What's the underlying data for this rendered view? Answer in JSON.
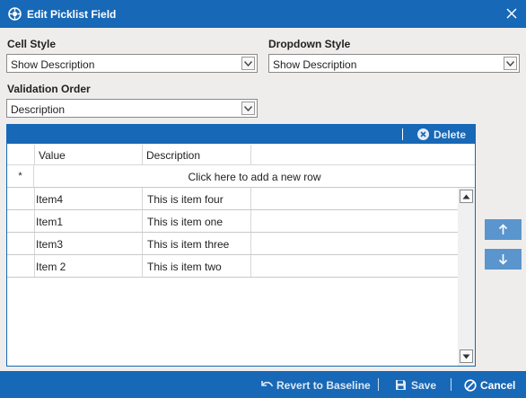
{
  "window": {
    "title": "Edit Picklist Field"
  },
  "fields": {
    "cell_style": {
      "label": "Cell Style",
      "value": "Show Description"
    },
    "dropdown_style": {
      "label": "Dropdown Style",
      "value": "Show Description"
    },
    "validation_order": {
      "label": "Validation Order",
      "value": "Description"
    }
  },
  "grid": {
    "delete_label": "Delete",
    "columns": [
      "Value",
      "Description"
    ],
    "new_row_marker": "*",
    "new_row_text": "Click here to add a new row",
    "rows": [
      {
        "value": "Item4",
        "description": "This is item four"
      },
      {
        "value": "Item1",
        "description": "This is item one"
      },
      {
        "value": "Item3",
        "description": "This is item three"
      },
      {
        "value": "Item 2",
        "description": "This is item two"
      }
    ]
  },
  "footer": {
    "revert_label": "Revert to Baseline",
    "save_label": "Save",
    "cancel_label": "Cancel"
  },
  "colors": {
    "accent": "#1768b6",
    "move_button": "#5a95cd",
    "background": "#efedec"
  },
  "icons": {
    "app": "app-logo-icon",
    "close": "close-icon",
    "delete": "delete-circle-x-icon",
    "move_up": "arrow-up-icon",
    "move_down": "arrow-down-icon",
    "revert": "undo-icon",
    "save": "floppy-disk-icon",
    "cancel": "prohibited-icon"
  }
}
